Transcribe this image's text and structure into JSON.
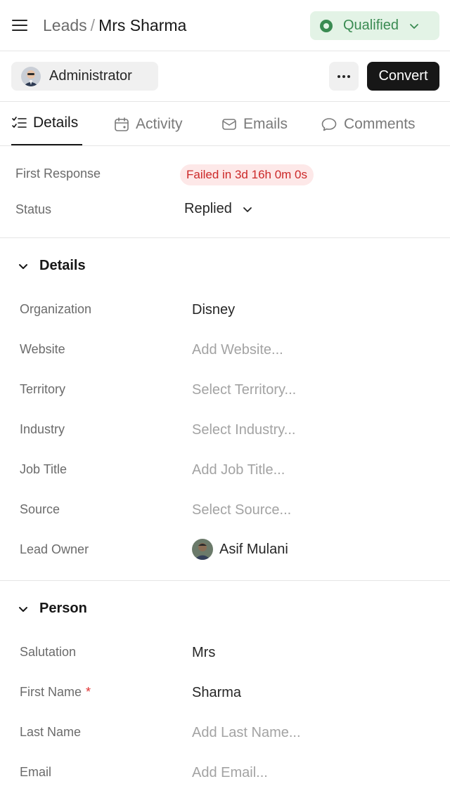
{
  "header": {
    "breadcrumb_parent": "Leads",
    "breadcrumb_separator": "/",
    "breadcrumb_current": "Mrs Sharma",
    "status_label": "Qualified",
    "status_color": "#3a8b52"
  },
  "actionbar": {
    "assignee_name": "Administrator",
    "more_icon": "ellipsis-icon",
    "convert_label": "Convert"
  },
  "tabs": [
    {
      "label": "Details",
      "icon": "list-icon"
    },
    {
      "label": "Activity",
      "icon": "calendar-icon"
    },
    {
      "label": "Emails",
      "icon": "mail-icon"
    },
    {
      "label": "Comments",
      "icon": "comment-icon"
    }
  ],
  "sla": {
    "first_response_label": "First Response",
    "first_response_value": "Failed in 3d 16h 0m 0s",
    "status_label": "Status",
    "status_value": "Replied"
  },
  "details_section": {
    "title": "Details",
    "fields": [
      {
        "label": "Organization",
        "value": "Disney"
      },
      {
        "label": "Website",
        "placeholder": "Add Website..."
      },
      {
        "label": "Territory",
        "placeholder": "Select Territory..."
      },
      {
        "label": "Industry",
        "placeholder": "Select Industry..."
      },
      {
        "label": "Job Title",
        "placeholder": "Add Job Title..."
      },
      {
        "label": "Source",
        "placeholder": "Select Source..."
      },
      {
        "label": "Lead Owner",
        "value": "Asif Mulani"
      }
    ]
  },
  "person_section": {
    "title": "Person",
    "fields": [
      {
        "label": "Salutation",
        "value": "Mrs"
      },
      {
        "label": "First Name",
        "value": "Sharma",
        "required_mark": "*"
      },
      {
        "label": "Last Name",
        "placeholder": "Add Last Name..."
      },
      {
        "label": "Email",
        "placeholder": "Add Email..."
      }
    ]
  },
  "colors": {
    "accent_dark": "#171717",
    "status_bg": "#e3f3e6",
    "sla_fail_bg": "#fde8e8",
    "sla_fail_text": "#cc2929"
  }
}
